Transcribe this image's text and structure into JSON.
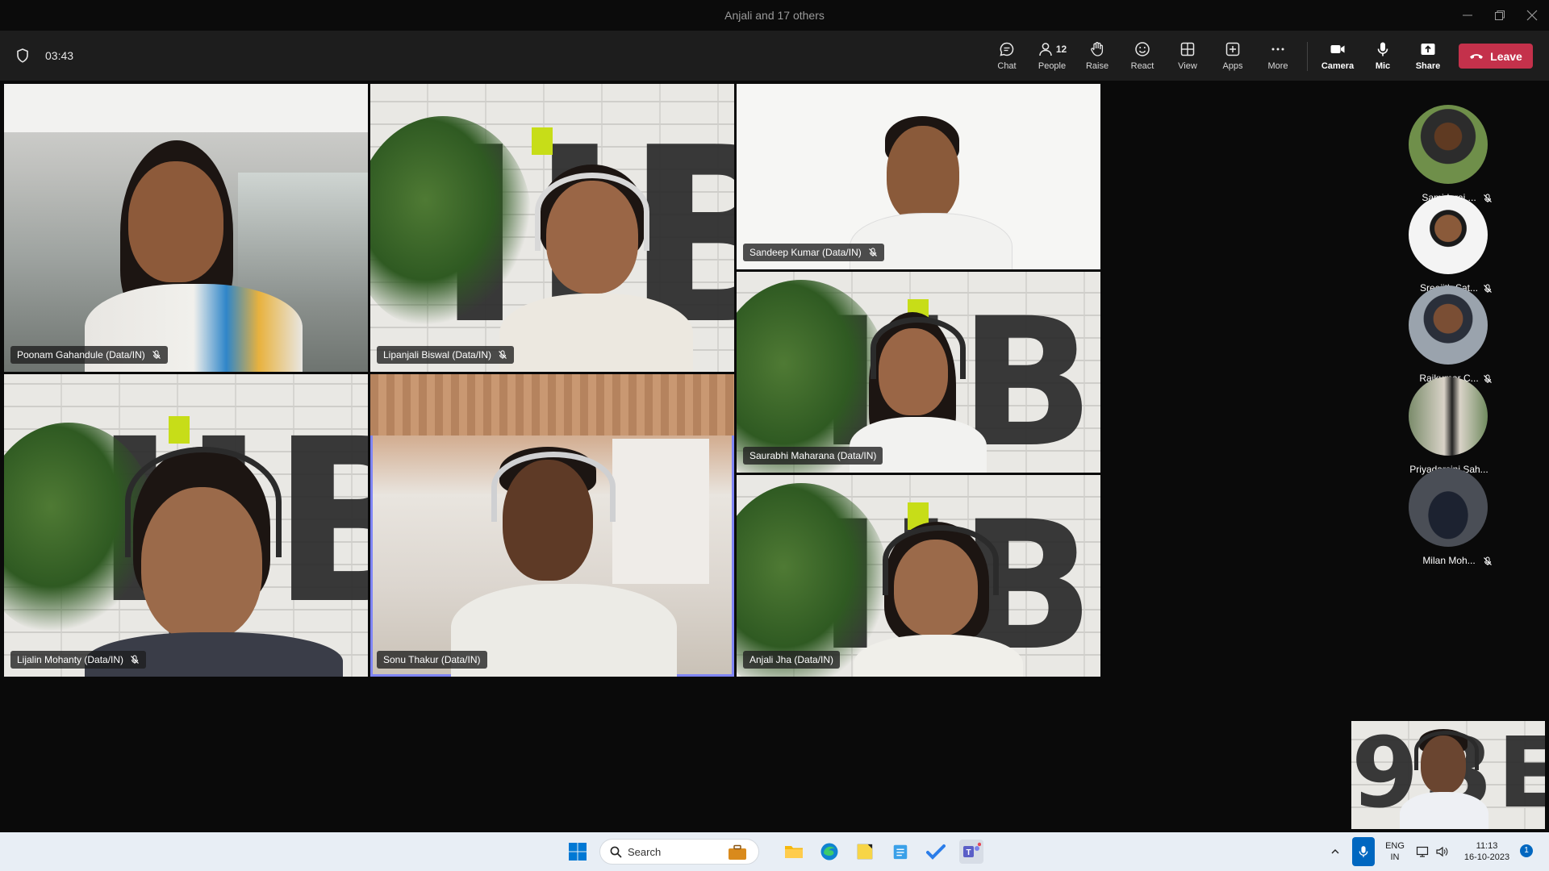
{
  "window": {
    "title": "Anjali and 17 others"
  },
  "toolbar": {
    "timer": "03:43",
    "chat_label": "Chat",
    "people_label": "People",
    "people_count": "12",
    "raise_label": "Raise",
    "react_label": "React",
    "view_label": "View",
    "apps_label": "Apps",
    "more_label": "More",
    "camera_label": "Camera",
    "mic_label": "Mic",
    "share_label": "Share",
    "leave_label": "Leave"
  },
  "participants": [
    {
      "name": "Poonam Gahandule (Data/IN)",
      "muted": true
    },
    {
      "name": "Lipanjali Biswal (Data/IN)",
      "muted": true
    },
    {
      "name": "Sandeep Kumar (Data/IN)",
      "muted": true
    },
    {
      "name": "Saurabhi Maharana (Data/IN)",
      "muted": false
    },
    {
      "name": "Lijalin Mohanty (Data/IN)",
      "muted": true
    },
    {
      "name": "Sonu Thakur (Data/IN)",
      "muted": false,
      "speaking": true
    },
    {
      "name": "Anjali Jha (Data/IN)",
      "muted": false
    }
  ],
  "rail": [
    {
      "name": "Samidurai ...",
      "muted": true
    },
    {
      "name": "Sreejith Sat...",
      "muted": true
    },
    {
      "name": "Rajkumar C...",
      "muted": true
    },
    {
      "name": "Priyadarsini Sah...",
      "muted": false
    },
    {
      "name": "Milan Moh...",
      "muted": true
    }
  ],
  "taskbar": {
    "search_placeholder": "Search",
    "lang_top": "ENG",
    "lang_bottom": "IN",
    "time": "11:13",
    "date": "16-10-2023",
    "notification_count": "1"
  },
  "colors": {
    "leave": "#c4314b",
    "speaking_outline": "#7f85f5",
    "brand_accent": "#c7dd18"
  }
}
